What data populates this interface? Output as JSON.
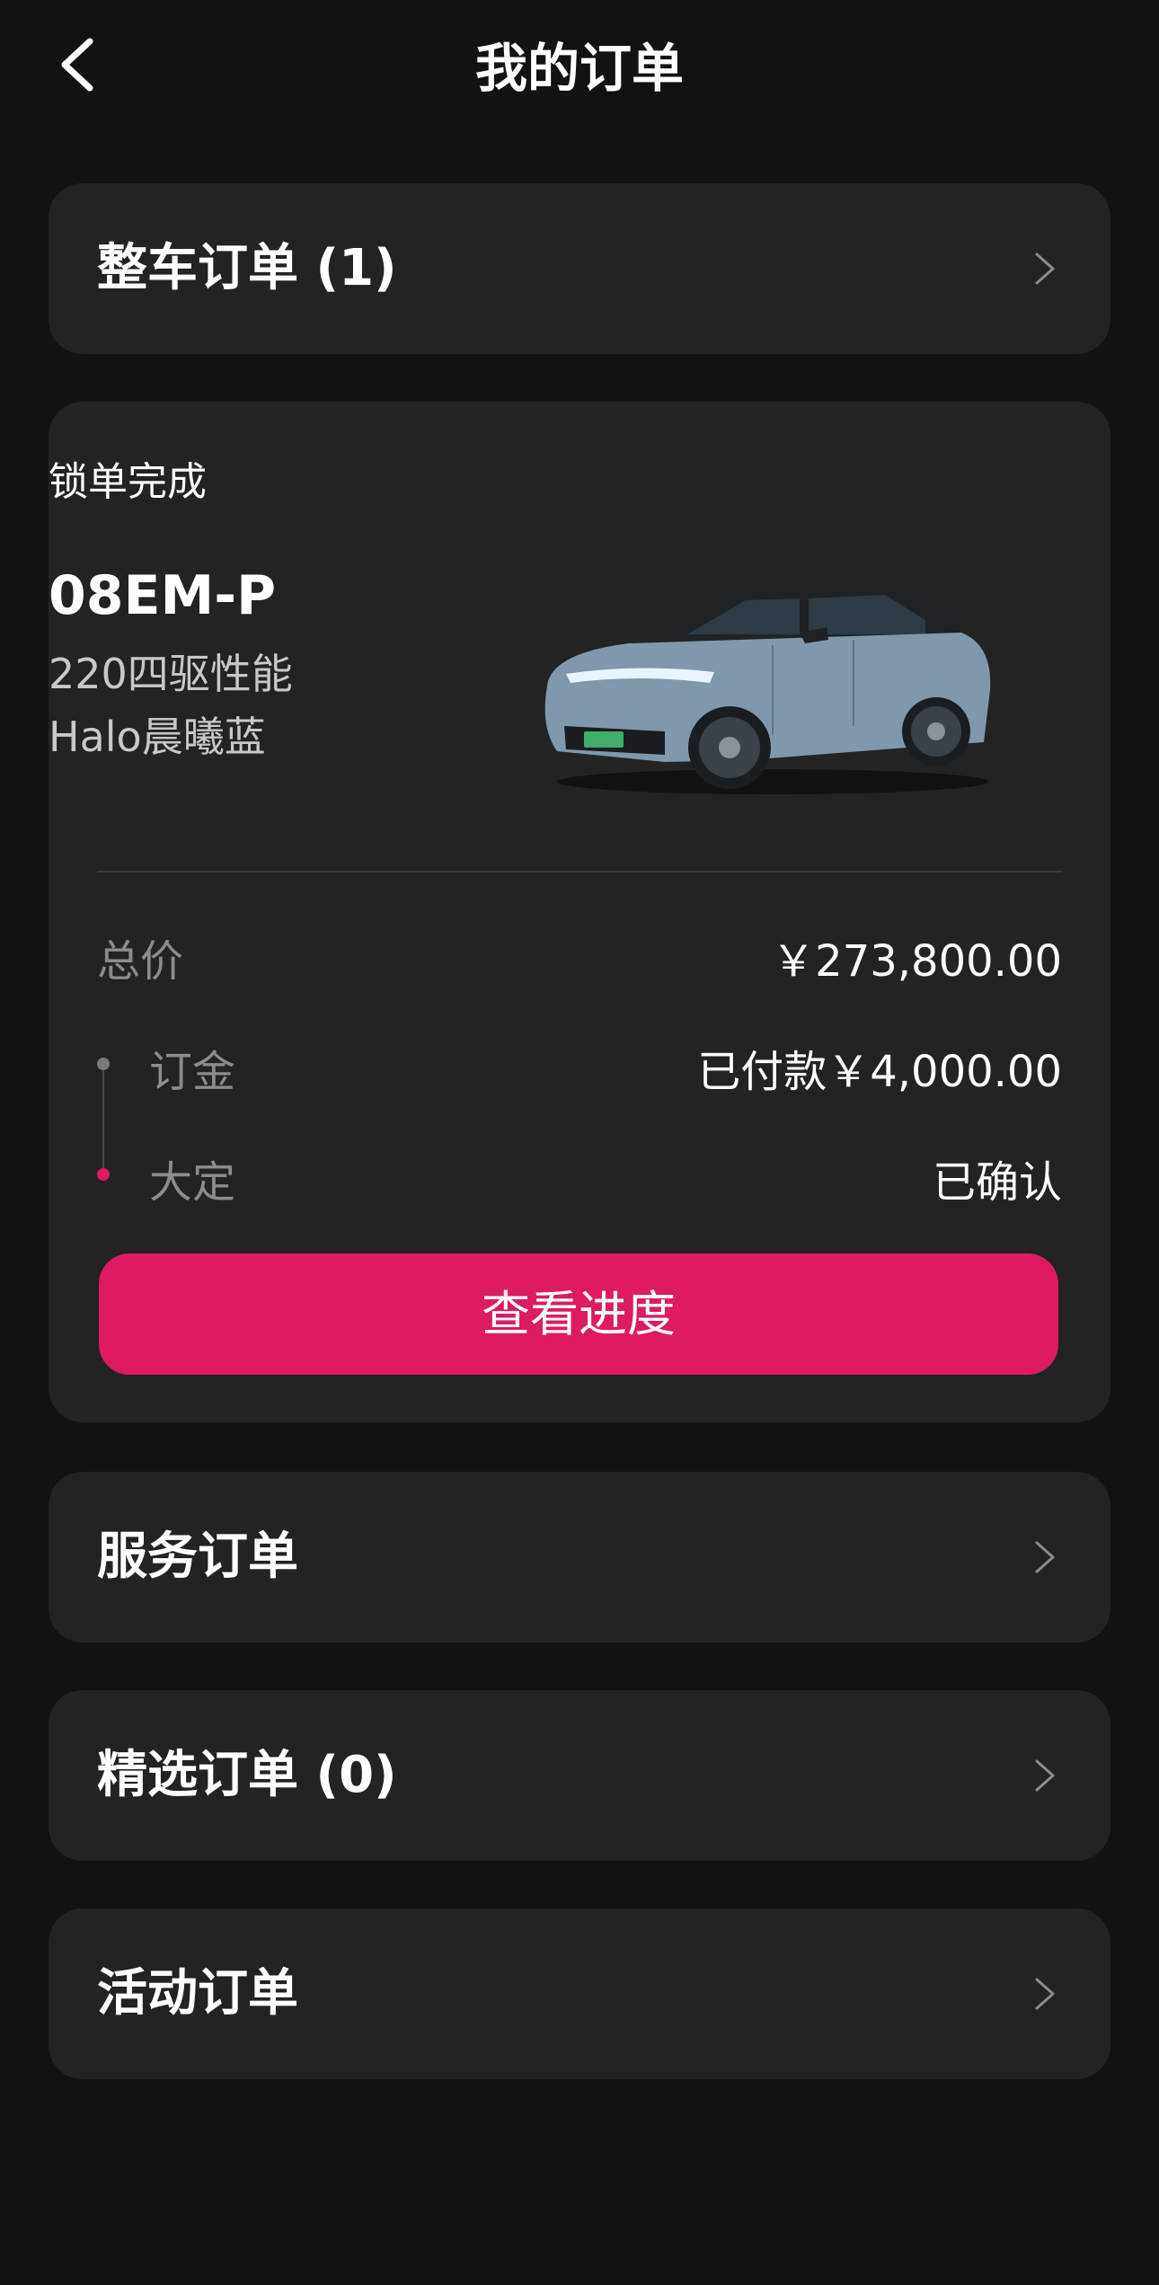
{
  "header": {
    "title": "我的订单",
    "back_icon": "chevron-left-icon"
  },
  "vehicle_orders": {
    "label": "整车订单 (1)"
  },
  "order": {
    "status": "锁单完成",
    "model": "08EM-P",
    "trim": "220四驱性能",
    "color": "Halo晨曦蓝",
    "car_colors": {
      "body": "#7f98ab",
      "roof": "#222629",
      "plate": "#3fae6a"
    },
    "total_label": "总价",
    "total_value": "￥273,800.00",
    "deposit_label": "订金",
    "deposit_value": "已付款￥4,000.00",
    "down_payment_label": "大定",
    "down_payment_value": "已确认",
    "progress_button": "查看进度"
  },
  "service_orders": {
    "label": "服务订单"
  },
  "selected_orders": {
    "label": "精选订单 (0)"
  },
  "activity_orders": {
    "label": "活动订单"
  },
  "colors": {
    "background": "#121212",
    "card": "#232323",
    "accent": "#dc1b63",
    "muted_text": "#8c8c8c"
  }
}
